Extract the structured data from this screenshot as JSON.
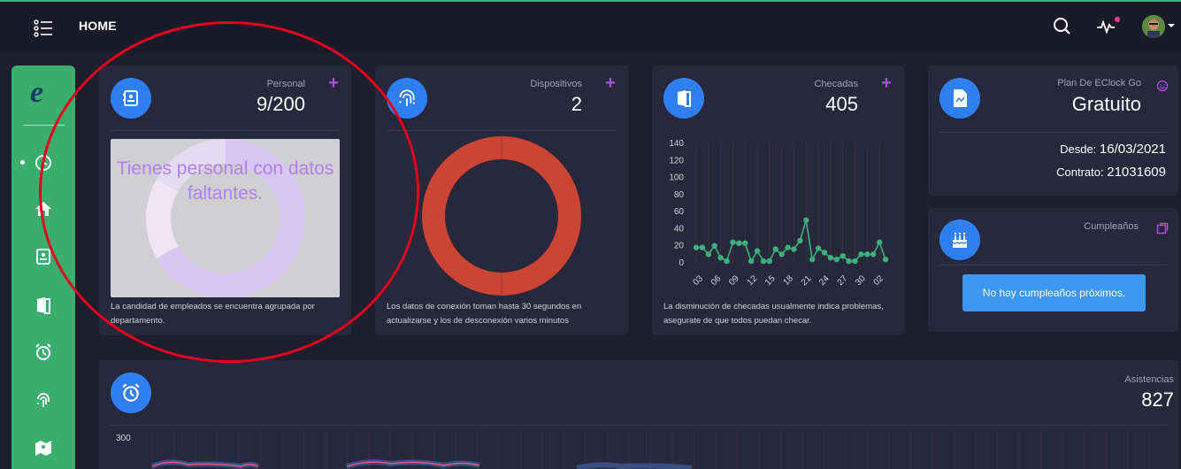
{
  "header": {
    "title": "HOME",
    "icons": [
      "menu-icon",
      "search-icon",
      "activity-icon",
      "avatar"
    ]
  },
  "sidebar": {
    "logo": "e",
    "items": [
      "dashboard-icon",
      "home-icon",
      "contacts-icon",
      "door-icon",
      "alarm-clock-icon",
      "fingerprint-icon",
      "map-icon"
    ]
  },
  "cards": {
    "personal": {
      "label": "Personal",
      "value": "9/200",
      "overlay": "Tienes personal con datos faltantes.",
      "footer": "La candidad de empleados se encuentra agrupada por departamento."
    },
    "dispositivos": {
      "label": "Dispositivos",
      "value": "2",
      "footer": "Los datos de conexión toman hasta 30 segundos en actualizarse y los de desconexión varios minutos"
    },
    "checadas": {
      "label": "Checadas",
      "value": "405",
      "footer": "La disminución de checadas usualmente indica problemas, asegurate de que todos puedan checar."
    },
    "plan": {
      "label": "Plan De EClock Go",
      "value": "Gratuito",
      "desde_label": "Desde:",
      "desde_value": "16/03/2021",
      "contrato_label": "Contrato:",
      "contrato_value": "21031609"
    },
    "cumpleanos": {
      "label": "Cumpleaños",
      "button": "No hay cumpleaños próximos."
    },
    "asistencias": {
      "label": "Asistencias",
      "value": "827",
      "y_top": "300"
    }
  },
  "colors": {
    "accent_blue": "#2f7ff0",
    "sidebar_green": "#3aae6f",
    "donut_red": "#cc4433",
    "line_green": "#3ab07a",
    "plus_purple": "#b04fe6"
  },
  "chart_data": [
    {
      "type": "line",
      "name": "checadas",
      "yticks": [
        0,
        20,
        40,
        60,
        80,
        100,
        120,
        140
      ],
      "ylim": [
        0,
        140
      ],
      "xticks": [
        "03",
        "06",
        "09",
        "12",
        "15",
        "18",
        "21",
        "24",
        "27",
        "30",
        "02"
      ],
      "values": [
        18,
        18,
        10,
        20,
        6,
        2,
        24,
        23,
        23,
        2,
        14,
        2,
        2,
        16,
        10,
        18,
        16,
        26,
        50,
        4,
        17,
        12,
        6,
        4,
        8,
        2,
        2,
        10,
        10,
        10,
        24,
        4
      ]
    },
    {
      "type": "pie",
      "name": "dispositivos",
      "values": [
        2
      ],
      "colors": [
        "#cc4433"
      ]
    },
    {
      "type": "pie",
      "name": "personal",
      "values": [
        6,
        1.5,
        1.5
      ],
      "colors": [
        "#d8c6f5",
        "#efe4f0",
        "#e4dcf3"
      ]
    }
  ]
}
